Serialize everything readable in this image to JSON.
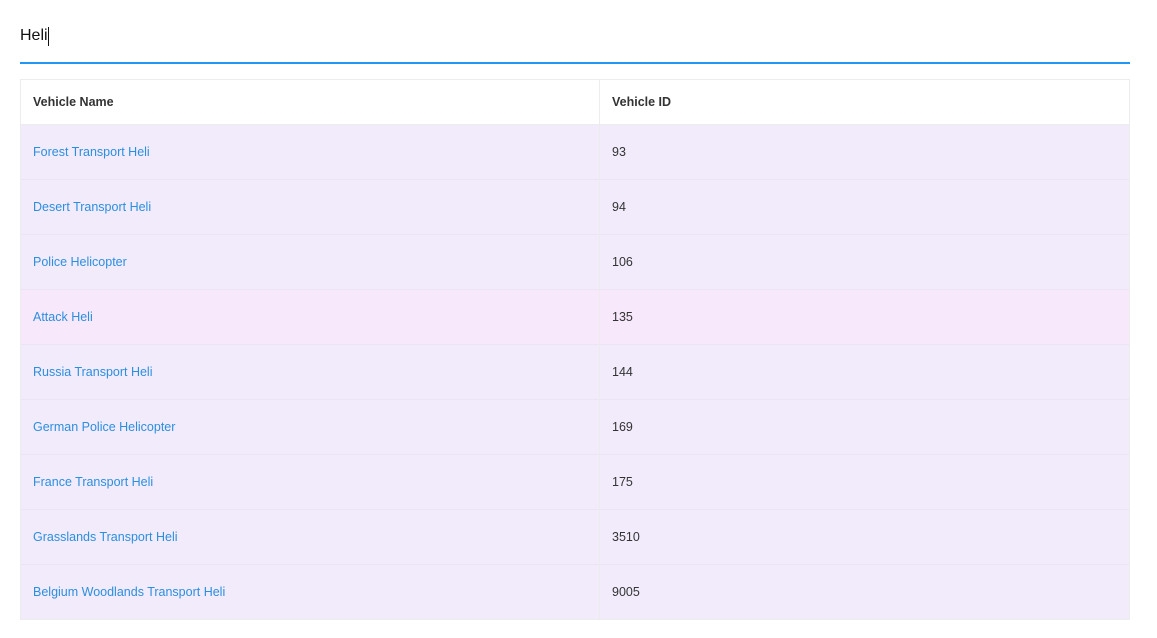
{
  "search": {
    "value": "Heli"
  },
  "table": {
    "headers": {
      "name": "Vehicle Name",
      "id": "Vehicle ID"
    },
    "rows": [
      {
        "name": "Forest Transport Heli",
        "id": "93"
      },
      {
        "name": "Desert Transport Heli",
        "id": "94"
      },
      {
        "name": "Police Helicopter",
        "id": "106"
      },
      {
        "name": "Attack Heli",
        "id": "135"
      },
      {
        "name": "Russia Transport Heli",
        "id": "144"
      },
      {
        "name": "German Police Helicopter",
        "id": "169"
      },
      {
        "name": "France Transport Heli",
        "id": "175"
      },
      {
        "name": "Grasslands Transport Heli",
        "id": "3510"
      },
      {
        "name": "Belgium Woodlands Transport Heli",
        "id": "9005"
      }
    ]
  },
  "colors": {
    "accent": "#2196f3",
    "link": "#2b8fe0",
    "row_background": "#f2ebfb",
    "row_highlight": "#f7e8fb"
  }
}
